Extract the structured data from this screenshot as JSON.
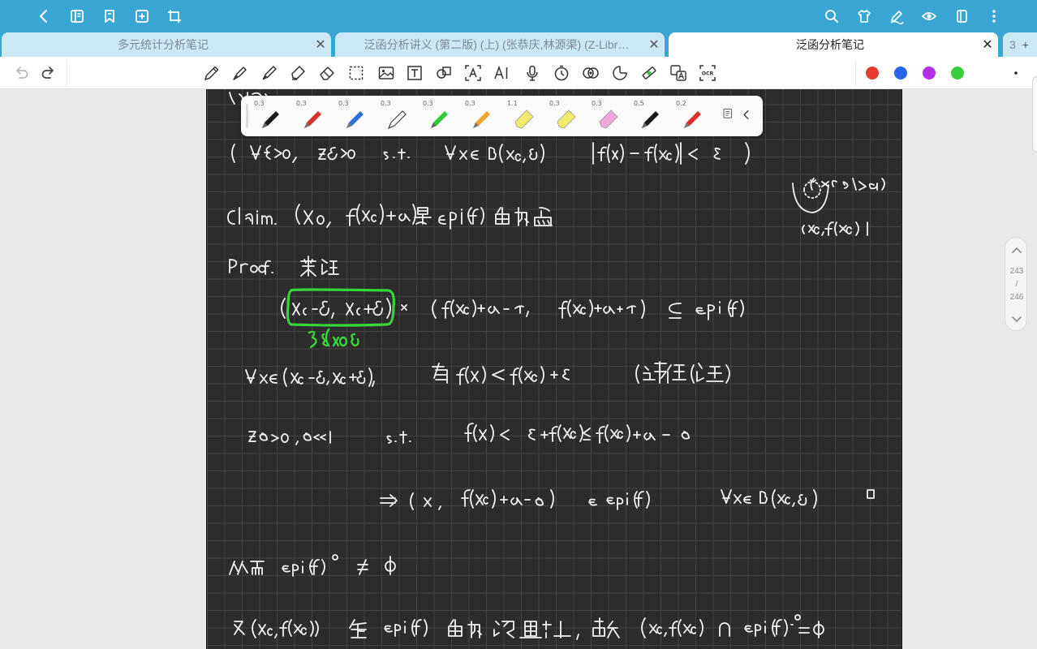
{
  "tabs": [
    {
      "label": "多元统计分析笔记",
      "active": false
    },
    {
      "label": "泛函分析讲义 (第二版) (上) (张恭庆,林源渠) (Z-Libr…",
      "active": false
    },
    {
      "label": "泛函分析笔记",
      "active": true
    }
  ],
  "tab_count": "3",
  "pen_palette": {
    "sizes": [
      "0.3",
      "0.3",
      "0.3",
      "0.3",
      "0.3",
      "0.3",
      "1.1",
      "0.3",
      "0.3",
      "0.5",
      "0.2"
    ],
    "colors": [
      "#1a1a1a",
      "#d9302c",
      "#2f6fd6",
      "#ffffff",
      "#31c83a",
      "#f2a42c",
      "#f2ec6c",
      "#f2ec6c",
      "#f0a8d8",
      "#1a1a1a",
      "#d9302c"
    ]
  },
  "quick_colors": [
    "#e53a2f",
    "#2766e8",
    "#b42fe6",
    "#39cc3b"
  ],
  "page_indicator": {
    "current": "243",
    "sep": "/",
    "total": "246"
  }
}
